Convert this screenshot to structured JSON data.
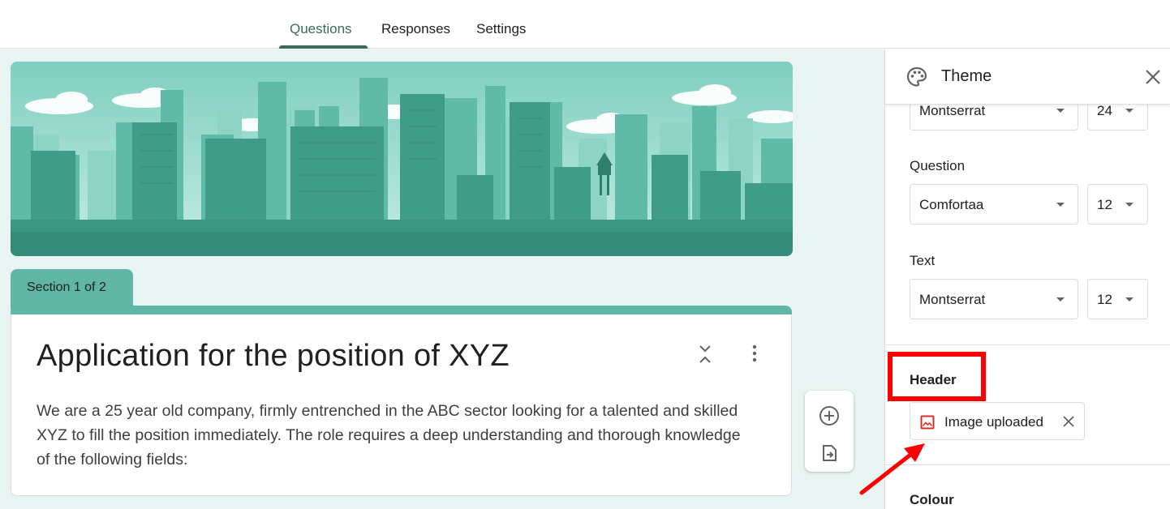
{
  "tabs": [
    {
      "label": "Questions",
      "active": true
    },
    {
      "label": "Responses",
      "active": false
    },
    {
      "label": "Settings",
      "active": false
    }
  ],
  "form": {
    "section_label": "Section 1 of 2",
    "title": "Application for the position of XYZ",
    "description": "We are a 25 year old company, firmly entrenched in the ABC sector looking for a talented and skilled XYZ to fill the position immediately. The role requires a deep understanding and thorough knowledge of the following fields:"
  },
  "theme_panel": {
    "title": "Theme",
    "header_font": {
      "font": "Montserrat",
      "size": "24"
    },
    "question": {
      "label": "Question",
      "font": "Comfortaa",
      "size": "12"
    },
    "text": {
      "label": "Text",
      "font": "Montserrat",
      "size": "12"
    },
    "header": {
      "label": "Header",
      "chip_label": "Image uploaded"
    },
    "colour": {
      "label": "Colour"
    }
  },
  "colors": {
    "accent": "#3a6b5d",
    "section": "#5fb6a4",
    "canvas_bg": "#e8f4f1",
    "highlight": "#ff0000"
  },
  "icons": [
    "palette-icon",
    "close-icon",
    "collapse-icon",
    "more-vert-icon",
    "add-circle-icon",
    "import-icon",
    "image-icon"
  ]
}
